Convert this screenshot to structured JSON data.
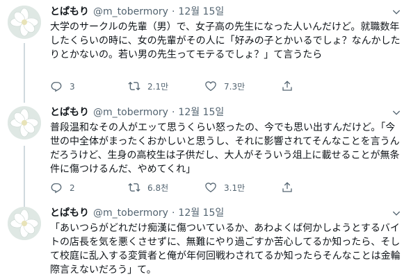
{
  "tweets": [
    {
      "name": "とぱもり",
      "handle": "@m_tobermory",
      "separator": "·",
      "date": "12월 15일",
      "text": "大学のサークルの先輩（男）で、女子高の先生になった人いんだけど。就職数年したくらいの時に、女の先輩がその人に「好みの子とかいるでしょ？なんかしたりとかないの。若い男の先生ってモテるでしょ？」て言うたら",
      "replies": "3",
      "retweets": "2.1만",
      "likes": "7.3만"
    },
    {
      "name": "とぱもり",
      "handle": "@m_tobermory",
      "separator": "·",
      "date": "12월 15일",
      "text": "普段温和なその人がエッて思うくらい怒ったの、今でも思い出すんだけど。「今世の中全体がまったくおかしいと思うし、それに影響されてそんなことを言うんだろうけど、生身の高校生は子供だし、大人がそういう俎上に載せることが無条件に傷つけるんだ、やめてくれ」",
      "replies": "2",
      "retweets": "6.8천",
      "likes": "3.1만"
    },
    {
      "name": "とぱもり",
      "handle": "@m_tobermory",
      "separator": "·",
      "date": "12월 15일",
      "text": "「あいつらがどれだけ痴漢に傷ついているか、あわよくば何かしようとするバイトの店長を気を悪くさせずに、無難にやり過ごすか苦心してるか知ったら、そして校庭に乱入する変質者と俺が年何回戦わされてるか知ったらそんなことは金輪際言えないだろう」て。",
      "replies": "",
      "retweets": "",
      "likes": ""
    }
  ],
  "icons": {
    "more": "chevron-down-icon",
    "reply": "reply-icon",
    "retweet": "retweet-icon",
    "like": "heart-icon",
    "share": "share-icon"
  },
  "colors": {
    "text": "#0f1419",
    "secondary": "#536471",
    "thread_line": "#cfd9de"
  }
}
